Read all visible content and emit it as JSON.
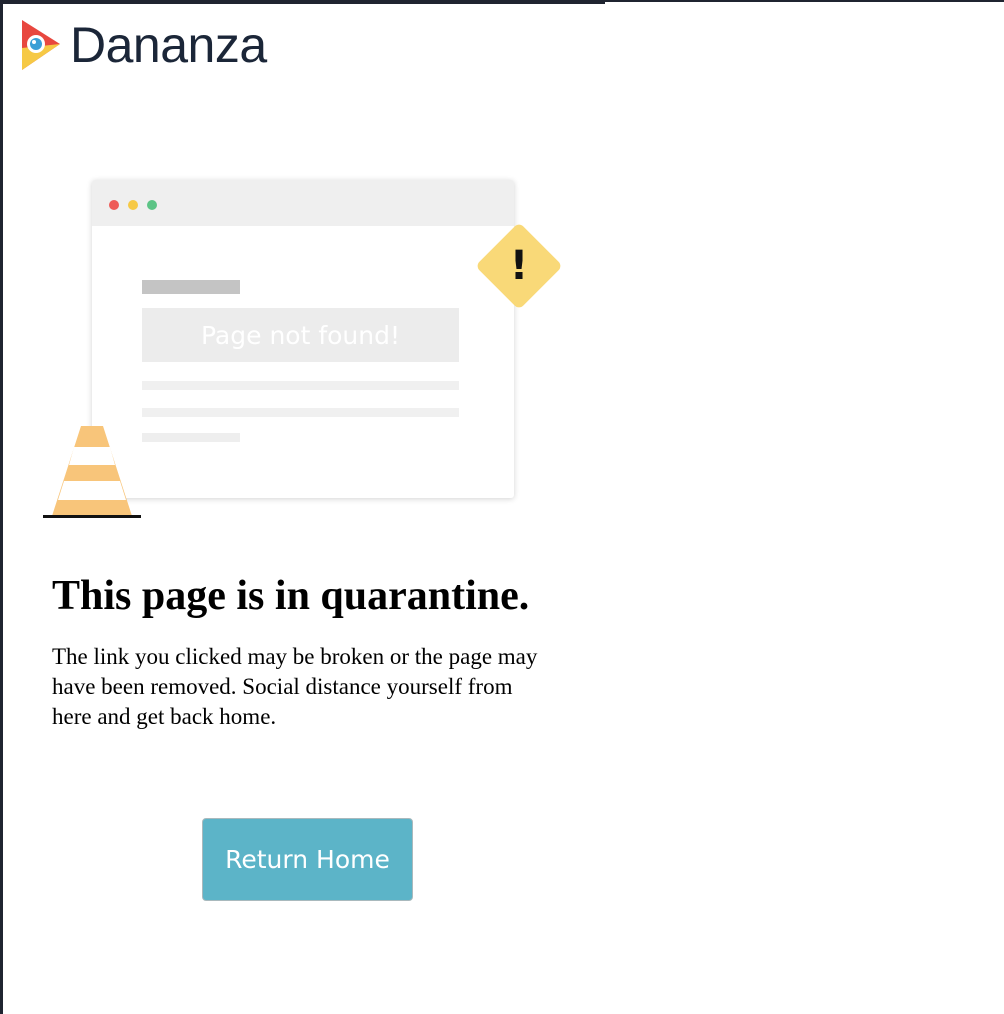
{
  "brand": {
    "name": "Dananza",
    "logo_icon": "dananza-play-logo-icon",
    "colors": {
      "red": "#e8473f",
      "yellow": "#f6c945",
      "blue": "#3a9fd6",
      "text": "#1b2638"
    }
  },
  "illustration": {
    "placeholder_text": "Page not found!",
    "warning_mark": "!",
    "warning_icon": "warning-diamond-icon",
    "cone_icon": "traffic-cone-icon",
    "colors": {
      "warning": "#f9d978",
      "cone": "#f8c57a"
    }
  },
  "main": {
    "title": "This page is in quarantine.",
    "description": "The link you clicked may be broken or the page may have been removed. Social distance yourself from here and get back home.",
    "button_label": "Return Home",
    "button_color": "#5cb4c8"
  }
}
